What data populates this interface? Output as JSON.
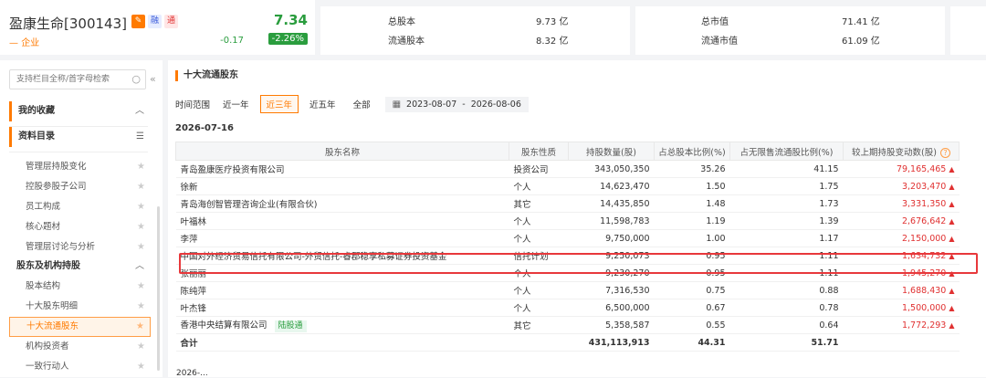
{
  "stock": {
    "name": "盈康生命[300143]",
    "tags": [
      "融",
      "通"
    ],
    "category": "企业",
    "price": "7.34",
    "change": "-0.17",
    "change_pct": "-2.26%"
  },
  "header_kv": {
    "total_shares_label": "总股本",
    "total_shares": "9.73 亿",
    "float_shares_label": "流通股本",
    "float_shares": "8.32 亿",
    "market_cap_label": "总市值",
    "market_cap": "71.41 亿",
    "float_cap_label": "流通市值",
    "float_cap": "61.09 亿"
  },
  "sidebar": {
    "search_placeholder": "支持栏目全称/首字母检索",
    "fav_label": "我的收藏",
    "catalog_label": "资料目录",
    "group1_items": [
      "管理层持股变化",
      "控股参股子公司",
      "员工构成",
      "核心题材",
      "管理层讨论与分析"
    ],
    "group2_label": "股东及机构持股",
    "group2_items": [
      "股本结构",
      "十大股东明细",
      "十大流通股东",
      "机构投资者",
      "一致行动人"
    ],
    "active_item": "十大流通股东"
  },
  "main": {
    "title": "十大流通股东",
    "range_label": "时间范围",
    "range_options": [
      "近一年",
      "近三年",
      "近五年",
      "全部"
    ],
    "range_active": "近三年",
    "date_start": "2023-08-07",
    "date_sep": "-",
    "date_end": "2026-08-06",
    "report_date": "2026-07-16",
    "next_report_date": "2026-...",
    "columns": [
      "股东名称",
      "股东性质",
      "持股数量(股)",
      "占总股本比例(%)",
      "占无限售流通股比例(%)",
      "较上期持股变动数(股)"
    ],
    "rows": [
      {
        "name": "青岛盈康医疗投资有限公司",
        "type": "投资公司",
        "shares": "343,050,350",
        "pct_total": "35.26",
        "pct_float": "41.15",
        "change": "79,165,465"
      },
      {
        "name": "徐新",
        "type": "个人",
        "shares": "14,623,470",
        "pct_total": "1.50",
        "pct_float": "1.75",
        "change": "3,203,470"
      },
      {
        "name": "青岛海创智管理咨询企业(有限合伙)",
        "type": "其它",
        "shares": "14,435,850",
        "pct_total": "1.48",
        "pct_float": "1.73",
        "change": "3,331,350"
      },
      {
        "name": "叶福林",
        "type": "个人",
        "shares": "11,598,783",
        "pct_total": "1.19",
        "pct_float": "1.39",
        "change": "2,676,642"
      },
      {
        "name": "李萍",
        "type": "个人",
        "shares": "9,750,000",
        "pct_total": "1.00",
        "pct_float": "1.17",
        "change": "2,150,000"
      },
      {
        "name": "中国对外经济贸易信托有限公司-外贸信托-睿郡稳享私募证券投资基金",
        "type": "信托计划",
        "shares": "9,250,073",
        "pct_total": "0.95",
        "pct_float": "1.11",
        "change": "1,634,732"
      },
      {
        "name": "张丽丽",
        "type": "个人",
        "shares": "9,230,270",
        "pct_total": "0.95",
        "pct_float": "1.11",
        "change": "1,945,270"
      },
      {
        "name": "陈纯萍",
        "type": "个人",
        "shares": "7,316,530",
        "pct_total": "0.75",
        "pct_float": "0.88",
        "change": "1,688,430"
      },
      {
        "name": "叶杰锋",
        "type": "个人",
        "shares": "6,500,000",
        "pct_total": "0.67",
        "pct_float": "0.78",
        "change": "1,500,000"
      },
      {
        "name": "香港中央结算有限公司",
        "badge": "陆股通",
        "type": "其它",
        "shares": "5,358,587",
        "pct_total": "0.55",
        "pct_float": "0.64",
        "change": "1,772,293"
      }
    ],
    "total": {
      "label": "合计",
      "shares": "431,113,913",
      "pct_total": "44.31",
      "pct_float": "51.71"
    }
  },
  "colors": {
    "accent": "#ff7a00",
    "down": "#2a9d3e",
    "up": "#e03131",
    "highlight": "#e8383b"
  },
  "icons": [
    "edit-icon",
    "search-icon",
    "collapse-icon",
    "chevron-up-icon",
    "menu-icon",
    "star-icon",
    "calendar-icon",
    "question-icon",
    "arrow-up-icon"
  ]
}
